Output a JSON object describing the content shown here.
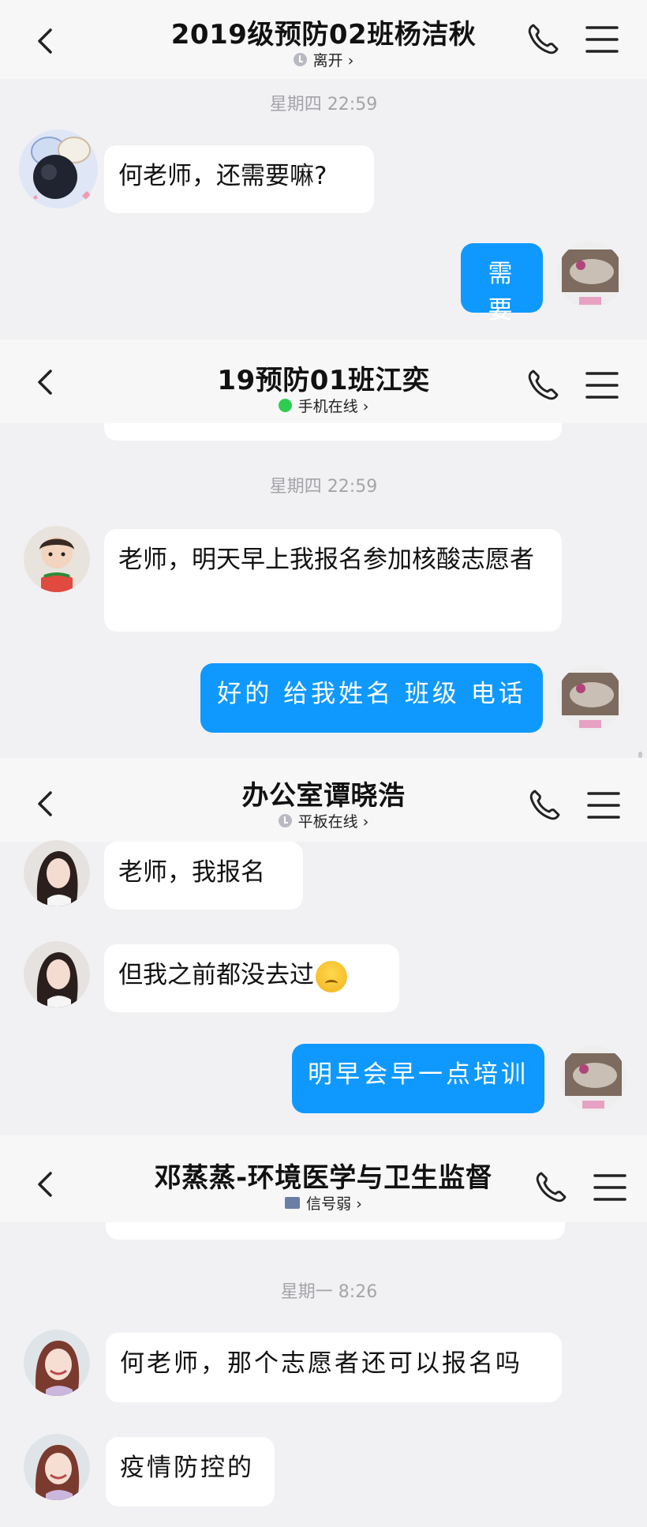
{
  "panels": [
    {
      "header": {
        "title": "2019级预防02班杨洁秋",
        "status": "离开 ›"
      },
      "timestamp": "星期四 22:59",
      "incoming": [
        "何老师，还需要嘛?"
      ],
      "outgoing": [
        "需要"
      ]
    },
    {
      "header": {
        "title": "19预防01班江奕",
        "status": "手机在线 ›"
      },
      "timestamp": "星期四 22:59",
      "incoming": [
        "老师，明天早上我报名参加核酸志愿者"
      ],
      "outgoing": [
        "好的 给我姓名 班级 电话"
      ]
    },
    {
      "header": {
        "title": "办公室谭晓浩",
        "status": "平板在线 ›"
      },
      "incoming": [
        "老师，我报名",
        "但我之前都没去过"
      ],
      "outgoing": [
        "明早会早一点培训"
      ]
    },
    {
      "header": {
        "title": "邓蒸蒸-环境医学与卫生监督",
        "status": "信号弱 ›"
      },
      "timestamp": "星期一 8:26",
      "incoming": [
        "何老师，那个志愿者还可以报名吗",
        "疫情防控的"
      ]
    }
  ],
  "icons": {
    "back": "chevron-left-icon",
    "call": "phone-icon",
    "menu": "hamburger-menu-icon",
    "emoji": "anxious-face-emoji"
  },
  "colors": {
    "outgoing_bubble": "#0f99ff",
    "incoming_bubble": "#ffffff",
    "background": "#f1f1f3",
    "online_dot": "#2ecc4f"
  }
}
